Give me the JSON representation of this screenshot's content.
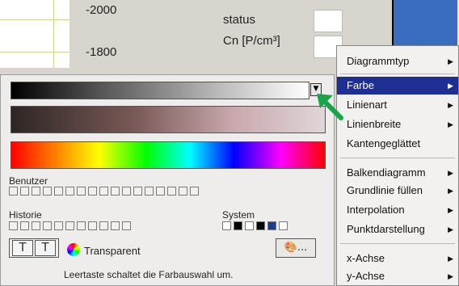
{
  "background": {
    "value_top": "-2000",
    "value_bottom": "-1800",
    "status_label": "status",
    "cn_label": "Cn [P/cm³]"
  },
  "picker": {
    "user_label": "Benutzer",
    "history_label": "Historie",
    "system_label": "System",
    "text_button_a": "T",
    "text_button_b": "T",
    "transparent_label": "Transparent",
    "palette_button": "...",
    "hint": "Leertaste schaltet die Farbauswahl um.",
    "system_colors": [
      "#ffffff",
      "#000000",
      "#ffffff",
      "#000000",
      "#1f3c8c",
      "#ffffff"
    ]
  },
  "menu": {
    "items": [
      {
        "label": "Diagrammtyp",
        "arrow": true,
        "selected": false
      },
      {
        "label": "Farbe",
        "arrow": true,
        "selected": true
      },
      {
        "label": "Linienart",
        "arrow": true,
        "selected": false
      },
      {
        "label": "Linienbreite",
        "arrow": true,
        "selected": false
      },
      {
        "label": "Kantengeglättet",
        "arrow": false,
        "selected": false
      },
      {
        "label": "Balkendiagramm",
        "arrow": true,
        "selected": false
      },
      {
        "label": "Grundlinie füllen",
        "arrow": true,
        "selected": false
      },
      {
        "label": "Interpolation",
        "arrow": true,
        "selected": false
      },
      {
        "label": "Punktdarstellung",
        "arrow": true,
        "selected": false
      },
      {
        "label": "x-Achse",
        "arrow": true,
        "selected": false
      },
      {
        "label": "y-Achse",
        "arrow": true,
        "selected": false
      }
    ]
  },
  "colors": {
    "menu_highlight": "#1f2e92",
    "arrow_green": "#1aa34a",
    "side_blue": "#3a6cc0"
  }
}
